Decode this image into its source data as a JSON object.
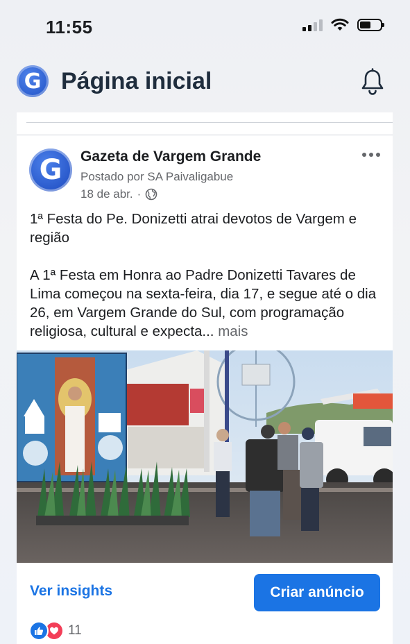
{
  "status_bar": {
    "time": "11:55"
  },
  "header": {
    "title": "Página inicial",
    "logo_letter": "G"
  },
  "post": {
    "page_name": "Gazeta de Vargem Grande",
    "avatar_letter": "G",
    "posted_by": "Postado por SA Paivaligabue",
    "date": "18 de abr.",
    "separator": "·",
    "title_line": "1ª Festa do Pe. Donizetti atrai devotos de Vargem e região",
    "body": "A 1ª Festa em Honra ao Padre Donizetti Tavares de Lima começou na sexta-feira, dia 17, e segue até o dia 26, em Vargem Grande do Sul, com programação religiosa, cultural e expecta...",
    "see_more": "mais",
    "reaction_count": "11"
  },
  "actions": {
    "insights_label": "Ver insights",
    "ad_button_label": "Criar anúncio"
  },
  "colors": {
    "accent": "#1b74e4",
    "love": "#f33e58",
    "muted": "#65676b"
  },
  "icons": [
    "signal-icon",
    "wifi-icon",
    "battery-icon",
    "bell-icon",
    "globe-icon",
    "more-icon",
    "like-icon",
    "love-icon"
  ]
}
